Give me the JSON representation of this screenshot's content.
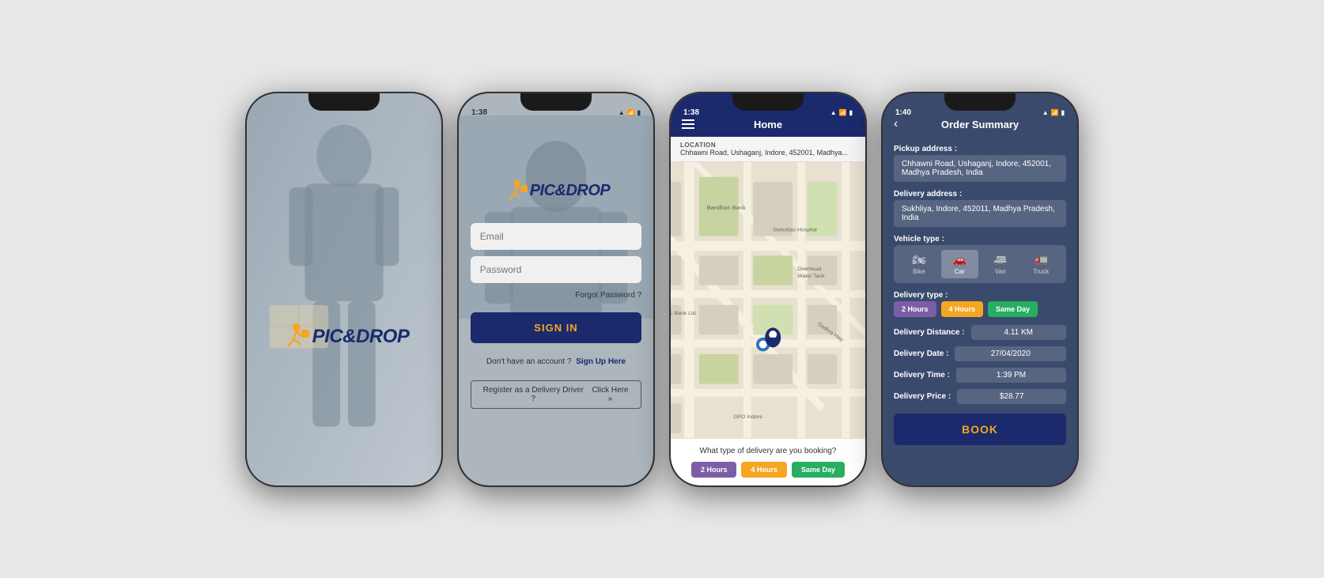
{
  "screen1": {
    "logo_text": "PIC&DROP",
    "logo_pic": "PIC",
    "logo_amp": "&",
    "logo_drop": "DROP"
  },
  "screen2": {
    "status_time": "1:38",
    "logo_text": "PIC&DROP",
    "email_placeholder": "Email",
    "password_placeholder": "Password",
    "forgot_password": "Forgot Password ?",
    "sign_in_btn": "SIGN IN",
    "dont_have_account": "Don't have an account ?",
    "sign_up_link": "Sign Up Here",
    "register_driver": "Register as a Delivery Driver ?",
    "click_here": "Click Here »"
  },
  "screen3": {
    "status_time": "1:38",
    "home_title": "Home",
    "location_label": "LOCATION",
    "location_text": "Chhawni Road, Ushaganj, Indore, 452001, Madhya...",
    "delivery_question": "What type of delivery are you booking?",
    "btn_2h": "2 Hours",
    "btn_4h": "4 Hours",
    "btn_same": "Same Day"
  },
  "screen4": {
    "status_time": "1:40",
    "title": "Order Summary",
    "back": "‹",
    "pickup_label": "Pickup address :",
    "pickup_value": "Chhawni Road, Ushaganj, Indore, 452001, Madhya Pradesh, India",
    "delivery_label": "Delivery address :",
    "delivery_value": "Sukhliya, Indore, 452011, Madhya Pradesh, India",
    "vehicle_label": "Vehicle type :",
    "vehicles": [
      "Bike",
      "Car",
      "Van",
      "Truck"
    ],
    "selected_vehicle": "Car",
    "delivery_type_label": "Delivery type :",
    "dt_2h": "2 Hours",
    "dt_4h": "4 Hours",
    "dt_same": "Same Day",
    "distance_label": "Delivery Distance :",
    "distance_value": "4.11 KM",
    "date_label": "Delivery Date :",
    "date_value": "27/04/2020",
    "time_label": "Delivery Time :",
    "time_value": "1:39 PM",
    "price_label": "Delivery Price :",
    "price_value": "$28.77",
    "book_btn": "BOOK"
  }
}
